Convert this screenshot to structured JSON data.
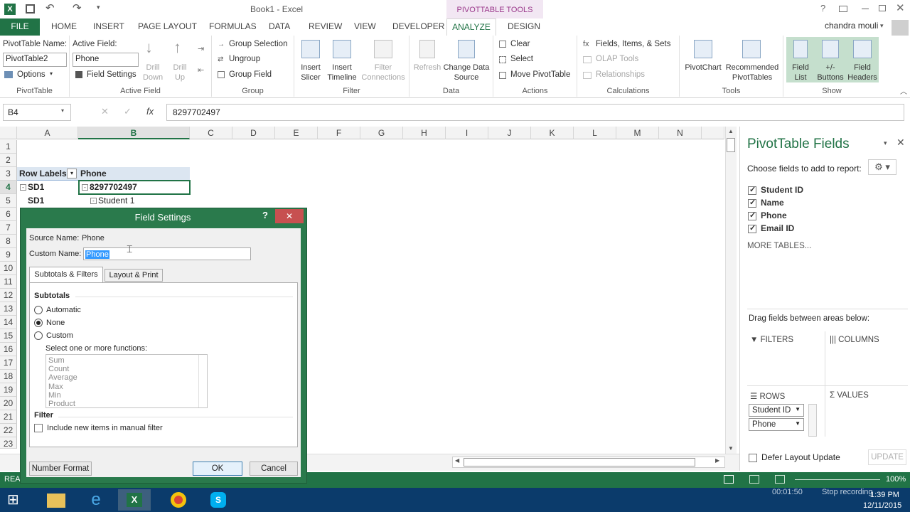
{
  "title": {
    "doc": "Book1 - Excel",
    "context_tab": "PIVOTTABLE TOOLS",
    "user": "chandra mouli"
  },
  "tabs": [
    "FILE",
    "HOME",
    "INSERT",
    "PAGE LAYOUT",
    "FORMULAS",
    "DATA",
    "REVIEW",
    "VIEW",
    "DEVELOPER",
    "ANALYZE",
    "DESIGN"
  ],
  "ribbon": {
    "pt_name_label": "PivotTable Name:",
    "pt_name": "PivotTable2",
    "options": "Options",
    "pivottable_group": "PivotTable",
    "active_field_label": "Active Field:",
    "active_field": "Phone",
    "field_settings": "Field Settings",
    "drill_down_1": "Drill",
    "drill_down_2": "Down",
    "drill_up_1": "Drill",
    "drill_up_2": "Up",
    "active_field_group": "Active Field",
    "group_selection": "Group Selection",
    "ungroup": "Ungroup",
    "group_field": "Group Field",
    "group_group": "Group",
    "insert_slicer_1": "Insert",
    "insert_slicer_2": "Slicer",
    "insert_timeline_1": "Insert",
    "insert_timeline_2": "Timeline",
    "filter_conn_1": "Filter",
    "filter_conn_2": "Connections",
    "filter_group": "Filter",
    "refresh": "Refresh",
    "change_ds_1": "Change Data",
    "change_ds_2": "Source",
    "data_group": "Data",
    "clear": "Clear",
    "select": "Select",
    "move_pt": "Move PivotTable",
    "actions_group": "Actions",
    "fields_items": "Fields, Items, & Sets",
    "olap": "OLAP Tools",
    "relationships": "Relationships",
    "calc_group": "Calculations",
    "pivotchart": "PivotChart",
    "recommended_1": "Recommended",
    "recommended_2": "PivotTables",
    "tools_group": "Tools",
    "field_list_1": "Field",
    "field_list_2": "List",
    "buttons_1": "+/-",
    "buttons_2": "Buttons",
    "headers_1": "Field",
    "headers_2": "Headers",
    "show_group": "Show"
  },
  "formula": {
    "namebox": "B4",
    "value": "8297702497",
    "fx": "fx"
  },
  "columns": [
    "A",
    "B",
    "C",
    "D",
    "E",
    "F",
    "G",
    "H",
    "I",
    "J",
    "K",
    "L",
    "M",
    "N"
  ],
  "rows": [
    "1",
    "2",
    "3",
    "4",
    "5",
    "6",
    "7",
    "8",
    "9",
    "10",
    "11",
    "12",
    "13",
    "14",
    "15",
    "16",
    "17",
    "18",
    "19",
    "20",
    "21",
    "22",
    "23"
  ],
  "cells": {
    "row_labels": "Row Labels",
    "phone_header": "Phone",
    "a4": "SD1",
    "b4": "8297702497",
    "a5": "SD1",
    "b5": "Student 1"
  },
  "pane": {
    "title": "PivotTable Fields",
    "choose": "Choose fields to add to report:",
    "fields": [
      "Student ID",
      "Name",
      "Phone",
      "Email ID"
    ],
    "more_tables": "MORE TABLES...",
    "drag": "Drag fields between areas below:",
    "filters": "FILTERS",
    "columns": "COLUMNS",
    "rows": "ROWS",
    "values": "VALUES",
    "row_fields": [
      "Student ID",
      "Phone"
    ],
    "defer": "Defer Layout Update",
    "update": "UPDATE"
  },
  "status": {
    "ready": "REA",
    "zoom": "100%",
    "recording": "00:01:50",
    "stop": "Stop recording"
  },
  "clock": {
    "time": "1:39 PM",
    "date": "12/11/2015"
  },
  "dialog": {
    "title": "Field Settings",
    "help": "?",
    "source_label": "Source Name:",
    "source_value": "Phone",
    "custom_label": "Custom Name:",
    "custom_value": "Phone",
    "tab1": "Subtotals & Filters",
    "tab2": "Layout & Print",
    "subtotals": "Subtotals",
    "automatic": "Automatic",
    "none": "None",
    "custom": "Custom",
    "select_functions": "Select one or more functions:",
    "functions": [
      "Sum",
      "Count",
      "Average",
      "Max",
      "Min",
      "Product"
    ],
    "filter": "Filter",
    "include_new": "Include new items in manual filter",
    "number_format": "Number Format",
    "ok": "OK",
    "cancel": "Cancel"
  }
}
